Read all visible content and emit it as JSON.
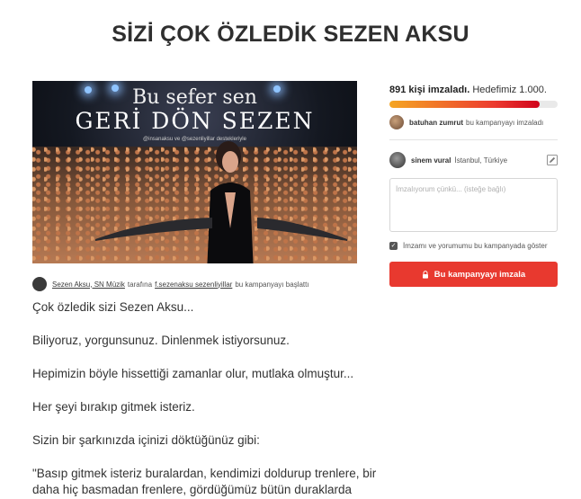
{
  "page": {
    "title": "SİZİ ÇOK ÖZLEDİK SEZEN AKSU"
  },
  "hero": {
    "line1": "Bu sefer sen",
    "line2": "GERİ DÖN SEZEN",
    "line3": "@insanaksu ve @sezenliyillar destekleriyle"
  },
  "starter": {
    "name": "Sezen Aksu, SN Müzik",
    "mid": "tarafına",
    "handle": "f.sezenaksu sezenliyillar",
    "suffix": "bu kampanyayı başlattı"
  },
  "petition_text": [
    "Çok özledik sizi Sezen Aksu...",
    "Biliyoruz, yorgunsunuz. Dinlenmek istiyorsunuz.",
    "Hepimizin böyle hissettiği zamanlar olur, mutlaka olmuştur...",
    "Her şeyi bırakıp gitmek isteriz.",
    "Sizin bir şarkınızda içinizi döktüğünüz gibi:",
    "\"Basıp gitmek isteriz buralardan, kendimizi doldurup trenlere, bir",
    "daha hiç basmadan frenlere, gördüğümüz bütün duraklarda"
  ],
  "stats": {
    "count": "891 kişi imzaladı.",
    "goal": "Hedefimiz 1.000.",
    "progress_fraction": 0.891
  },
  "recent_signer": {
    "name": "batuhan zumrut",
    "action": "bu kampanyayı imzaladı"
  },
  "current_user": {
    "name": "sinem vural",
    "location": "İstanbul, Türkiye"
  },
  "comment": {
    "placeholder": "İmzalıyorum çünkü... (isteğe bağlı)"
  },
  "checkbox": {
    "label": "İmzamı ve yorumumu bu kampanyada göster",
    "checked": true
  },
  "sign_button": {
    "label": "Bu kampanyayı imzala"
  },
  "colors": {
    "accent": "#e8392f",
    "progress_start": "#f5a623",
    "progress_end": "#d0021b"
  }
}
